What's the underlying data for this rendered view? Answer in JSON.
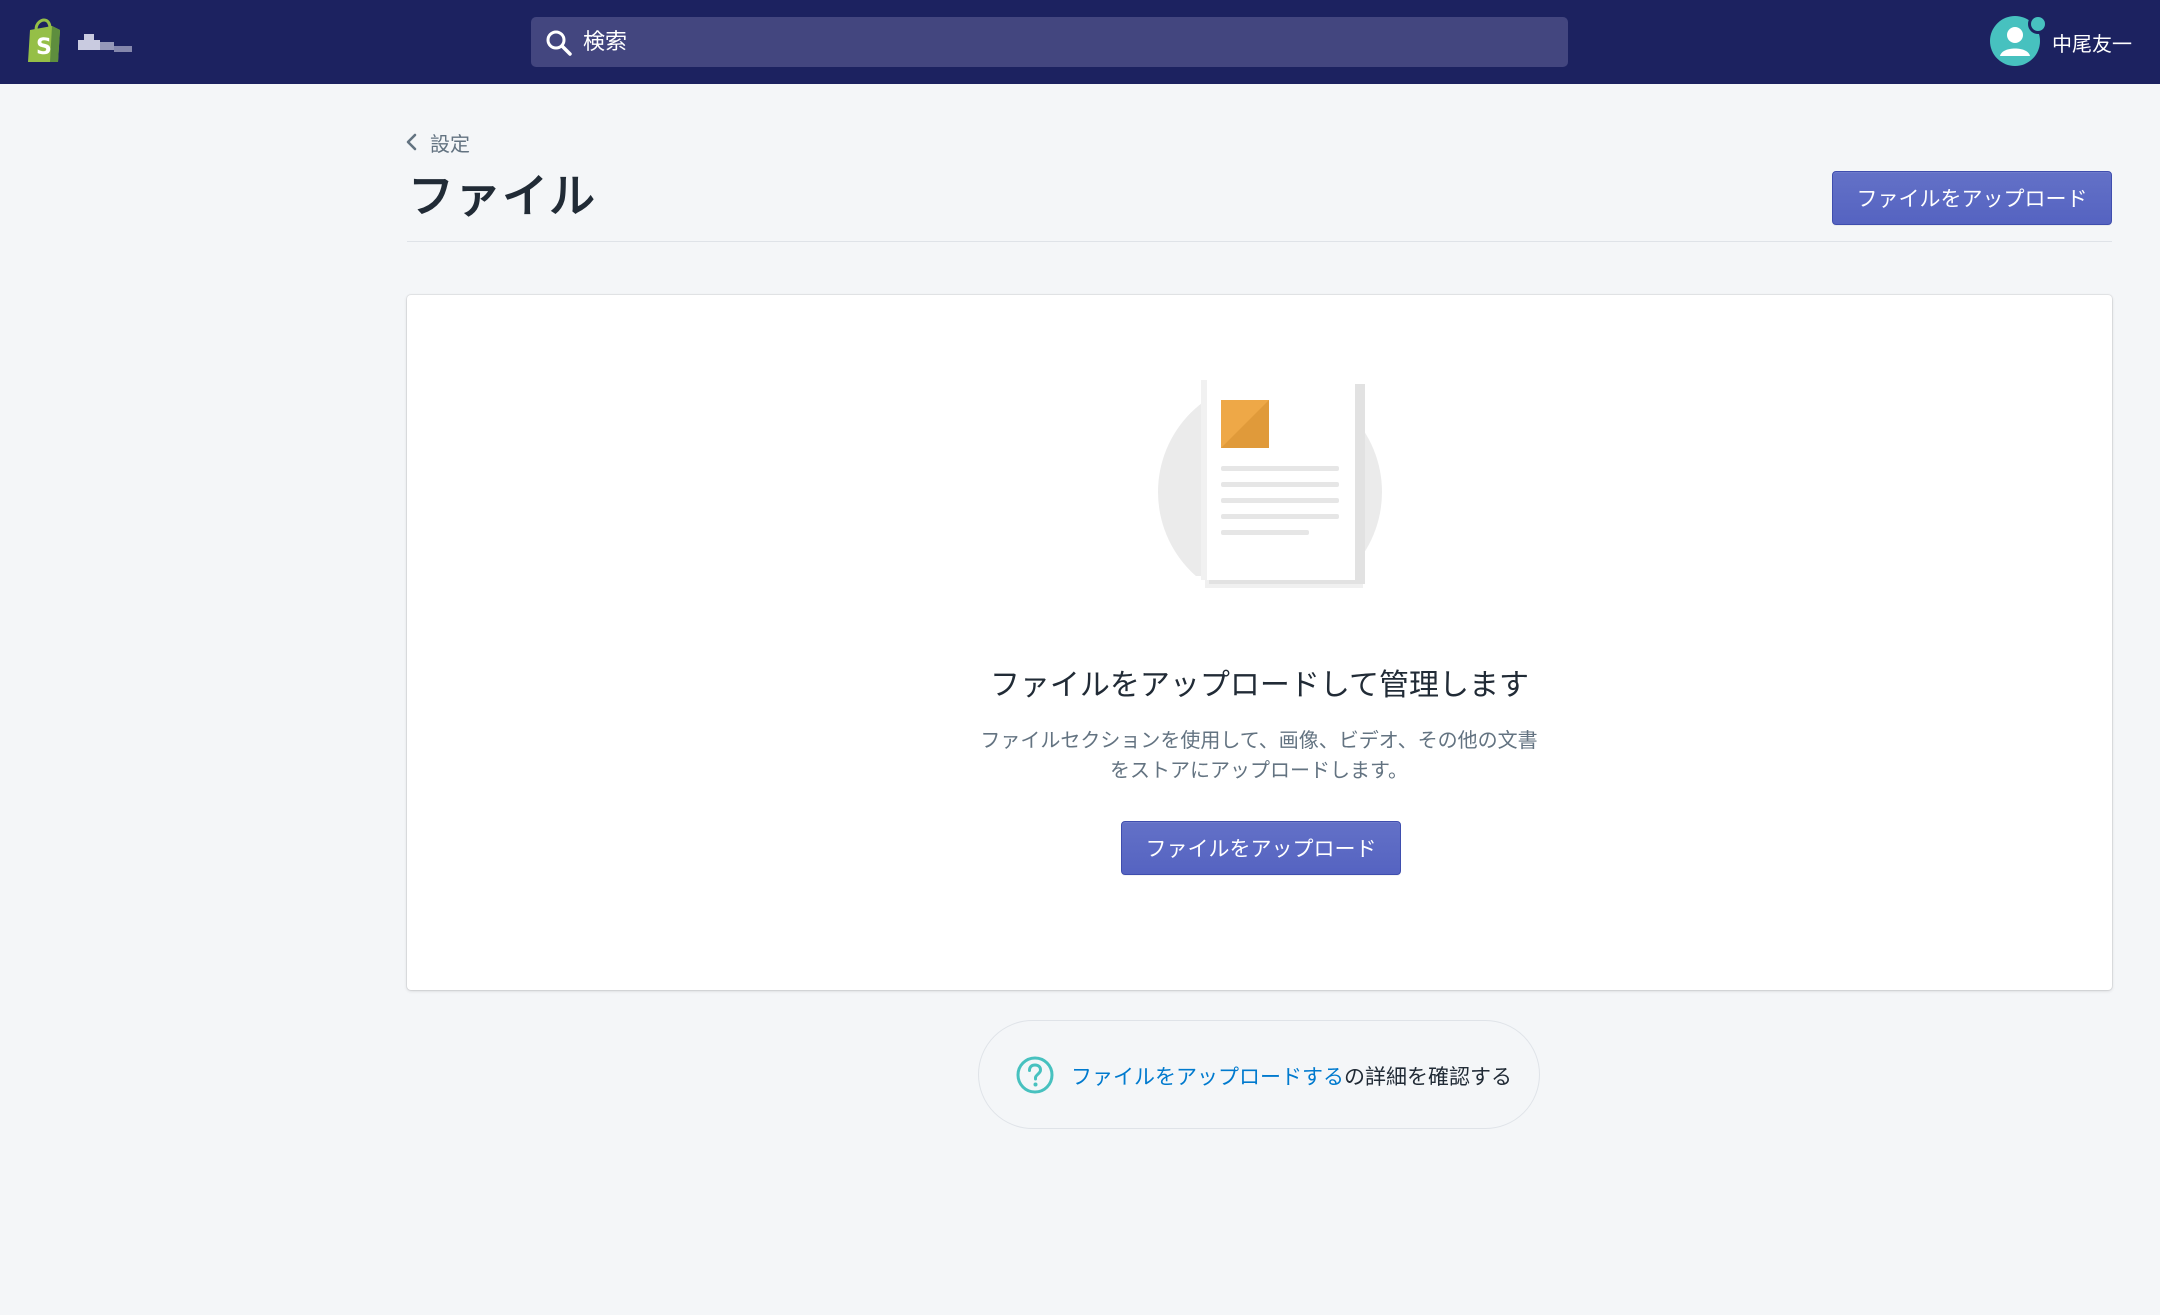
{
  "topbar": {
    "search": {
      "placeholder": "検索"
    },
    "user": {
      "name": "中尾友一"
    },
    "colors": {
      "bar": "#1c2260",
      "search_bg": "#43467f",
      "avatar": "#47c1bf"
    }
  },
  "header": {
    "breadcrumb": "設定",
    "title": "ファイル",
    "upload_button": "ファイルをアップロード"
  },
  "empty_state": {
    "heading": "ファイルをアップロードして管理します",
    "description_line1": "ファイルセクションを使用して、画像、ビデオ、その他の文書",
    "description_line2": "をストアにアップロードします。",
    "upload_button": "ファイルをアップロード"
  },
  "footer_help": {
    "link_text": "ファイルをアップロードする",
    "suffix": "の詳細を確認する",
    "icon": "question-circle-icon"
  },
  "colors": {
    "primary_button": "#5c6ac4",
    "link": "#007ace",
    "page_bg": "#f4f6f8"
  }
}
